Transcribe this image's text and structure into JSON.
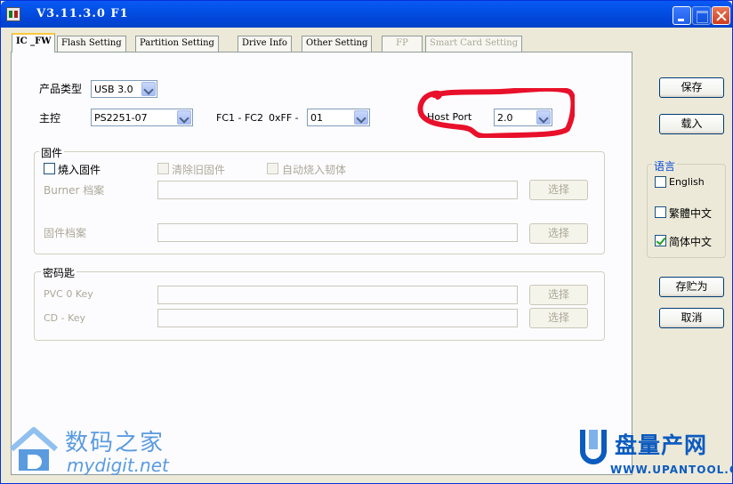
{
  "window": {
    "title": "V3.11.3.0 F1"
  },
  "tabs": [
    {
      "label": "IC _FW",
      "active": true,
      "enabled": true
    },
    {
      "label": "Flash Setting",
      "active": false,
      "enabled": true
    },
    {
      "label": "Partition Setting",
      "active": false,
      "enabled": true
    },
    {
      "label": "Drive Info",
      "active": false,
      "enabled": true
    },
    {
      "label": "Other Setting",
      "active": false,
      "enabled": true
    },
    {
      "label": "FP",
      "active": false,
      "enabled": false
    },
    {
      "label": "Smart Card Setting",
      "active": false,
      "enabled": false
    }
  ],
  "ic_fw": {
    "product_type": {
      "label": "产品类型",
      "value": "USB 3.0"
    },
    "controller": {
      "label": "主控",
      "value": "PS2251-07"
    },
    "fc": {
      "label": "FC1 - FC2",
      "prefix": "0xFF -",
      "value": "01"
    },
    "host_port": {
      "label": "Host Port",
      "value": "2.0"
    }
  },
  "firmware": {
    "title": "固件",
    "burn_fw_label": "燒入固件",
    "clear_old_label": "清除旧固件",
    "auto_burn_label": "自动烧入韧体",
    "burner_label": "Burner 档案",
    "burner_value": "",
    "fw_file_label": "固件档案",
    "fw_file_value": "",
    "select_label": "选择"
  },
  "keys": {
    "title": "密码匙",
    "pvc_label": "PVC 0 Key",
    "pvc_value": "",
    "cd_label": "CD - Key",
    "cd_value": "",
    "select_label": "选择"
  },
  "side": {
    "save_label": "保存",
    "load_label": "载入",
    "language_title": "语言",
    "languages": [
      {
        "label": "English",
        "checked": false
      },
      {
        "label": "繁體中文",
        "checked": false
      },
      {
        "label": "简体中文",
        "checked": true
      }
    ],
    "save_as_label": "存贮为",
    "cancel_label": "取消"
  },
  "watermarks": {
    "left_title": "数码之家",
    "left_url": "mydigit.net",
    "right_title": "盘量产网",
    "right_url": "WWW.UPANTOOL.COM"
  },
  "colors": {
    "titlebar": "#0352e8",
    "highlight": "#e8102a",
    "watermark_left": "#5a9be0",
    "watermark_right": "#0c5bbf"
  }
}
